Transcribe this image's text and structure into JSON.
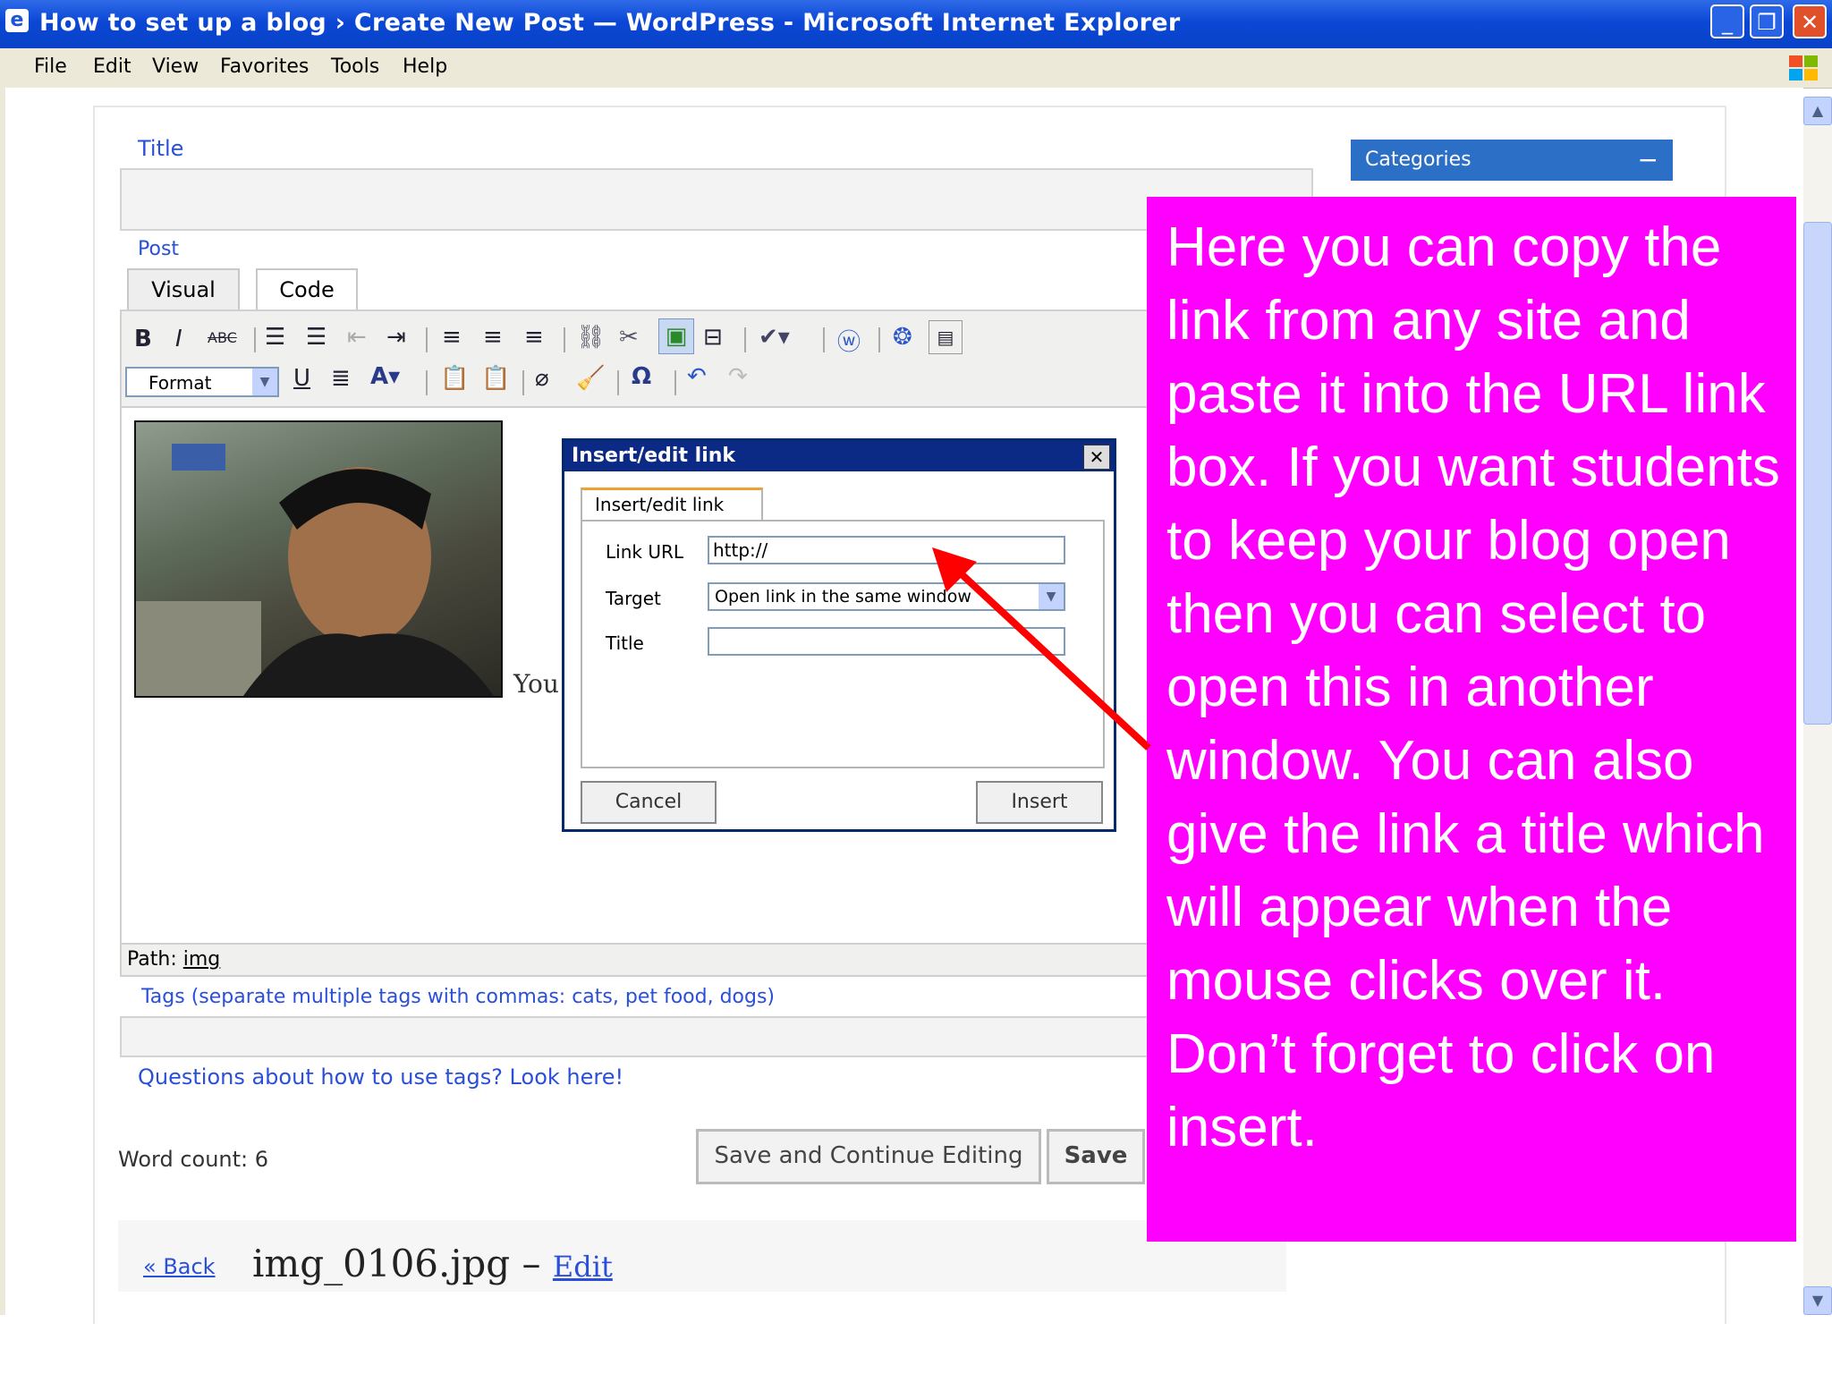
{
  "window": {
    "title": "How to set up a blog › Create New Post — WordPress - Microsoft Internet Explorer",
    "app_icon": "ie-icon",
    "buttons": [
      "minimize",
      "restore",
      "close"
    ]
  },
  "menu": [
    "File",
    "Edit",
    "View",
    "Favorites",
    "Tools",
    "Help"
  ],
  "form": {
    "title_label": "Title",
    "post_label": "Post",
    "tab_visual": "Visual",
    "tab_code": "Code",
    "format_select": "Format",
    "path_label": "Path:",
    "path_value": "img",
    "tags_label": "Tags (separate multiple tags with commas: cats, pet food, dogs)",
    "tags_help_link": "Questions about how to use tags? Look here!",
    "word_count": "Word count: 6",
    "caption_fragment": "You",
    "save_continue_button": "Save and Continue Editing",
    "save_button": "Save"
  },
  "sidebar": {
    "categories_title": "Categories",
    "collapse_symbol": "−"
  },
  "footer": {
    "back_link": "« Back",
    "filename": "img_0106.jpg",
    "dash": "–",
    "edit_link": "Edit"
  },
  "dialog": {
    "title": "Insert/edit link",
    "tab": "Insert/edit link",
    "link_url_label": "Link URL",
    "link_url_value": "http://",
    "target_label": "Target",
    "target_value": "Open link in the same window",
    "title_label": "Title",
    "title_value": "",
    "cancel_button": "Cancel",
    "insert_button": "Insert"
  },
  "callout": {
    "text": "Here you can copy the link from any site and paste it into the URL link box.  If you want students to keep your blog open then you can select to open this in another window. You can also give the link a title which will appear when the mouse clicks over it. Don’t forget to click on insert.",
    "color": "#ff00ff",
    "arrow_color": "#ff0000"
  }
}
